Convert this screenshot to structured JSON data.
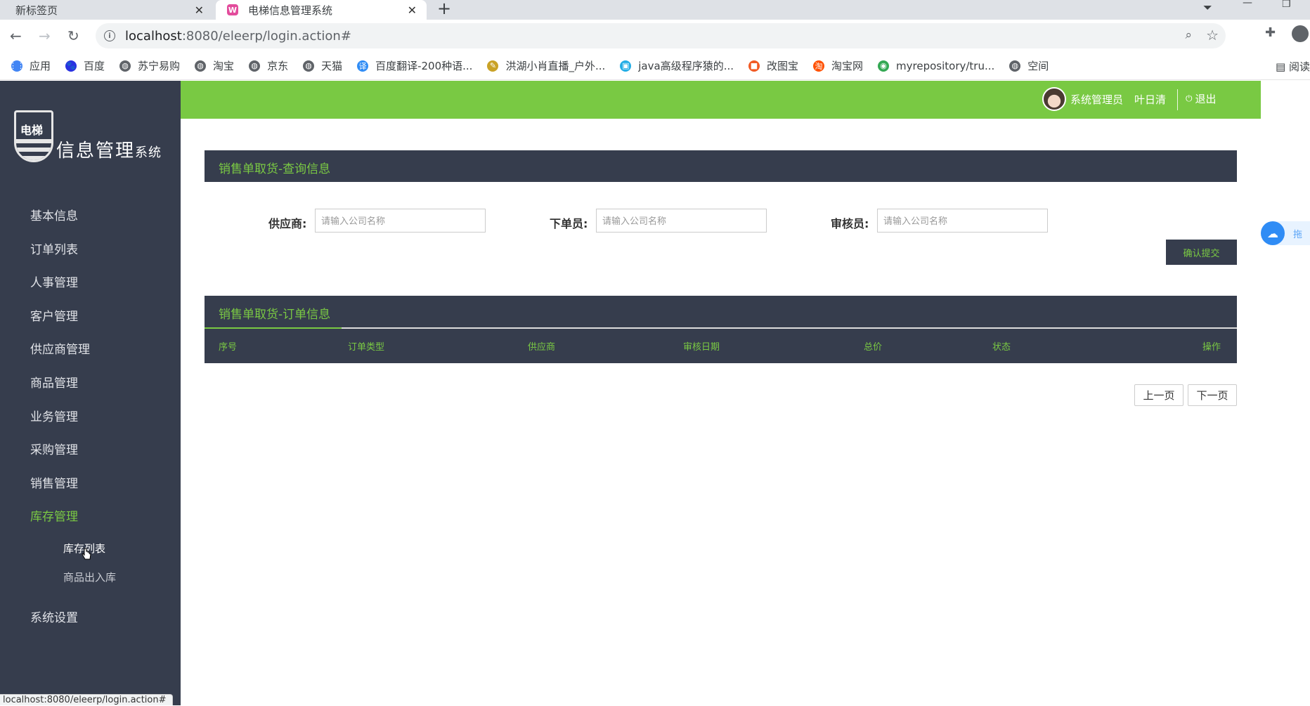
{
  "browser": {
    "tabs": [
      {
        "title": "新标签页",
        "active": false
      },
      {
        "title": "电梯信息管理系统",
        "active": true
      }
    ],
    "url_host": "localhost",
    "url_rest": ":8080/eleerp/login.action#",
    "bookmarks": [
      {
        "label": "应用",
        "icon": "apps-grid-icon",
        "color": "#4285f4"
      },
      {
        "label": "百度",
        "icon": "baidu-paw-icon",
        "color": "#2932e1"
      },
      {
        "label": "苏宁易购",
        "icon": "globe-icon",
        "color": "#5f6368"
      },
      {
        "label": "淘宝",
        "icon": "globe-icon",
        "color": "#5f6368"
      },
      {
        "label": "京东",
        "icon": "globe-icon",
        "color": "#5f6368"
      },
      {
        "label": "天猫",
        "icon": "globe-icon",
        "color": "#5f6368"
      },
      {
        "label": "百度翻译-200种语...",
        "icon": "translate-icon",
        "color": "#2f8cf5"
      },
      {
        "label": "洪湖小肖直播_户外...",
        "icon": "feather-icon",
        "color": "#c9a227"
      },
      {
        "label": "java高级程序猿的...",
        "icon": "bilibili-icon",
        "color": "#23ade5"
      },
      {
        "label": "改图宝",
        "icon": "gaitubao-icon",
        "color": "#f15a24"
      },
      {
        "label": "淘宝网",
        "icon": "taobao-icon",
        "color": "#ff5000"
      },
      {
        "label": "myrepository/tru...",
        "icon": "chrome-icon",
        "color": "#34a853"
      },
      {
        "label": "空间",
        "icon": "globe-icon",
        "color": "#5f6368"
      }
    ],
    "reading_list": "阅读",
    "status_url": "localhost:8080/eleerp/login.action#"
  },
  "logo": {
    "shield_text": "电梯",
    "title_main": "信息管理",
    "title_small": "系统"
  },
  "topbar": {
    "role": "系统管理员",
    "name": "叶日清",
    "logout": "退出"
  },
  "sidebar": {
    "items": [
      {
        "label": "基本信息"
      },
      {
        "label": "订单列表"
      },
      {
        "label": "人事管理"
      },
      {
        "label": "客户管理"
      },
      {
        "label": "供应商管理"
      },
      {
        "label": "商品管理"
      },
      {
        "label": "业务管理"
      },
      {
        "label": "采购管理"
      },
      {
        "label": "销售管理"
      },
      {
        "label": "库存管理",
        "active": true
      }
    ],
    "subitems": [
      {
        "label": "库存列表"
      },
      {
        "label": "商品出入库"
      }
    ],
    "settings": "系统设置"
  },
  "query": {
    "title": "销售单取货-查询信息",
    "fields": [
      {
        "label": "供应商:",
        "placeholder": "请输入公司名称",
        "value": ""
      },
      {
        "label": "下单员:",
        "placeholder": "请输入公司名称",
        "value": ""
      },
      {
        "label": "审核员:",
        "placeholder": "请输入公司名称",
        "value": ""
      }
    ],
    "submit": "确认提交"
  },
  "orders": {
    "title": "销售单取货-订单信息",
    "columns": [
      "序号",
      "订单类型",
      "供应商",
      "审核日期",
      "总价",
      "状态",
      "操作"
    ],
    "rows": []
  },
  "pagination": {
    "prev": "上一页",
    "next": "下一页"
  },
  "float_widget": {
    "text": "拖"
  },
  "colors": {
    "sidebar_bg": "#363d4d",
    "accent_green": "#7ac943",
    "topbar_green": "#79c943"
  }
}
